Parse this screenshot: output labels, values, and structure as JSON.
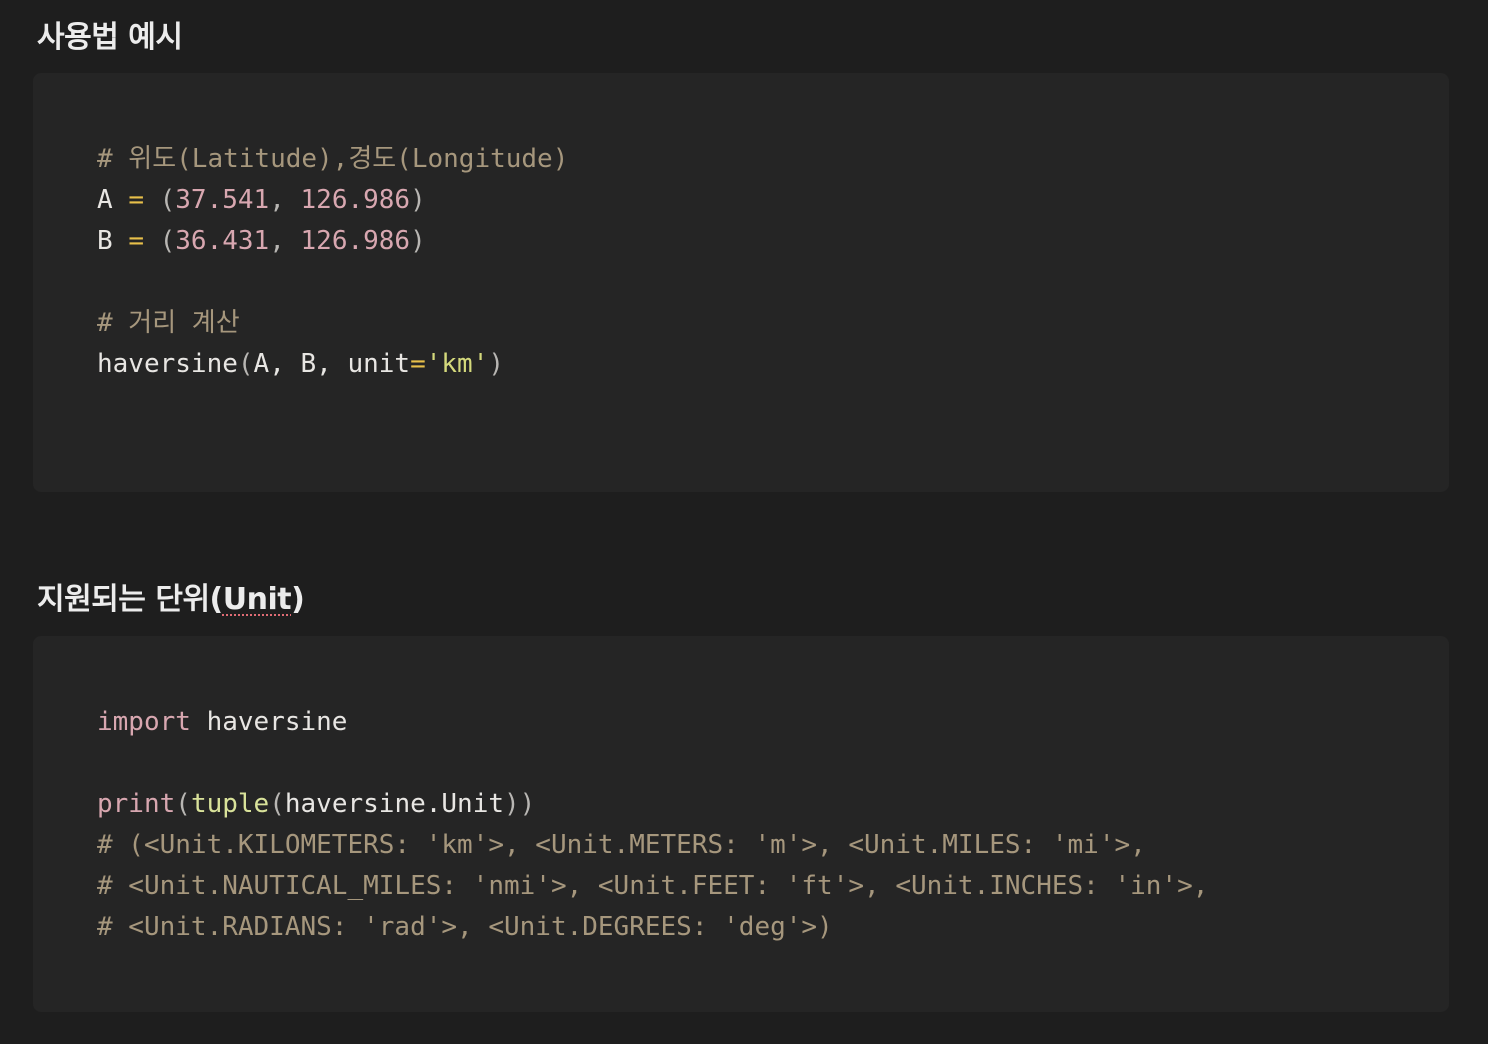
{
  "section1": {
    "title": "사용법 예시",
    "code": {
      "comment1": "# 위도(Latitude),경도(Longitude)",
      "lineA": {
        "var": "A",
        "op": "=",
        "open": "(",
        "lat": "37.541",
        "sep": ", ",
        "lon": "126.986",
        "close": ")"
      },
      "lineB": {
        "var": "B",
        "op": "=",
        "open": "(",
        "lat": "36.431",
        "sep": ", ",
        "lon": "126.986",
        "close": ")"
      },
      "comment2": "# 거리 계산",
      "call": {
        "func": "haversine",
        "open": "(",
        "args": "A, B, unit",
        "eq": "=",
        "str": "'km'",
        "close": ")"
      }
    }
  },
  "section2": {
    "title_prefix": "지원되는 단위(",
    "title_unit": "Unit",
    "title_suffix": ")",
    "code": {
      "import_kw": "import",
      "import_mod": " haversine",
      "print_fn": "print",
      "open1": "(",
      "tuple_fn": "tuple",
      "open2": "(",
      "arg": "haversine.Unit",
      "close": "))",
      "out1": "# (<Unit.KILOMETERS: 'km'>, <Unit.METERS: 'm'>, <Unit.MILES: 'mi'>,",
      "out2": "# <Unit.NAUTICAL_MILES: 'nmi'>, <Unit.FEET: 'ft'>, <Unit.INCHES: 'in'>,",
      "out3": "# <Unit.RADIANS: 'rad'>, <Unit.DEGREES: 'deg'>)"
    }
  }
}
